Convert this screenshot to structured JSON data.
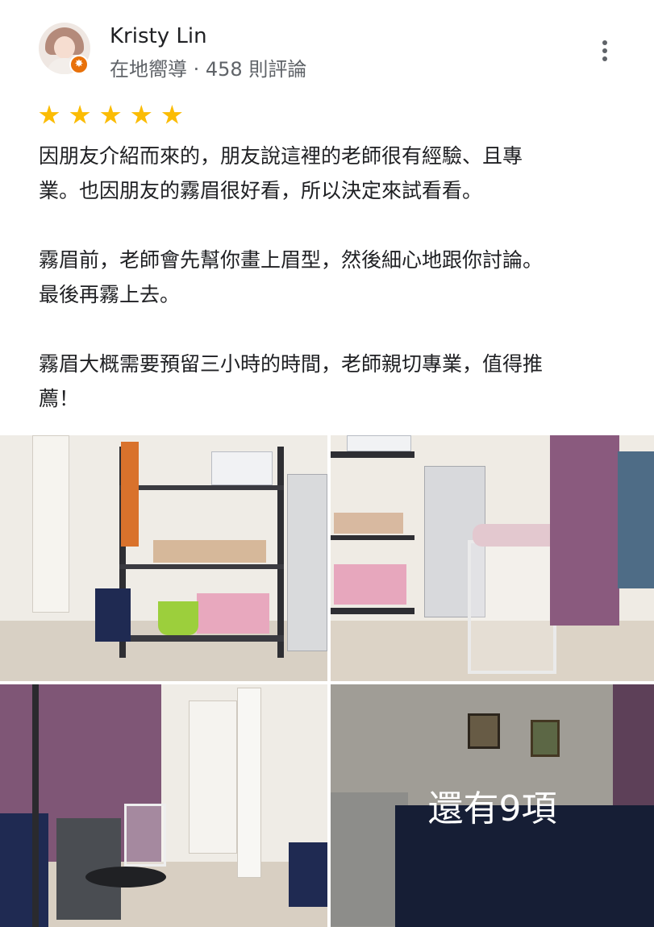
{
  "reviewer": {
    "name": "Kristy Lin",
    "meta": "在地嚮導 · 458 則評論",
    "badge_icon": "local-guide-badge-icon"
  },
  "rating": 5,
  "review": {
    "paragraphs": [
      "因朋友介紹而來的，朋友說這裡的老師很有經驗、且專\n業。也因朋友的霧眉很好看，所以決定來試看看。",
      "霧眉前，老師會先幫你畫上眉型，然後細心地跟你討論。\n最後再霧上去。",
      "霧眉大概需要預留三小時的時間，老師親切專業，值得推\n薦！"
    ]
  },
  "photos": {
    "more_label": "還有9項"
  },
  "colors": {
    "star": "#fbbc04",
    "badge": "#e8710a",
    "secondary_text": "#5f6368"
  }
}
